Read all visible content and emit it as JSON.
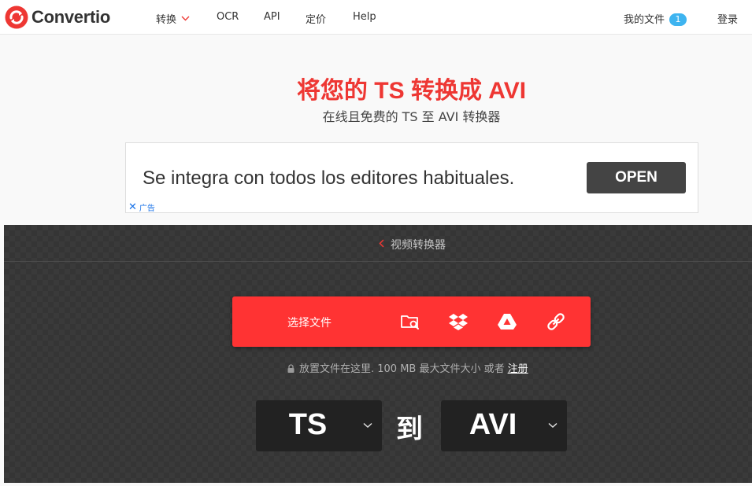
{
  "header": {
    "logo_text": "Convertio",
    "nav": {
      "convert": "转换",
      "ocr": "OCR",
      "api": "API",
      "pricing": "定价",
      "help": "Help"
    },
    "my_files": "我的文件",
    "my_files_count": "1",
    "login": "登录",
    "brand_color": "#ee3733",
    "badge_color": "#3eb4f0"
  },
  "hero": {
    "title": "将您的 TS 转换成 AVI",
    "subtitle": "在线且免费的 TS 至 AVI 转换器"
  },
  "ad": {
    "text": "Se integra con todos los editores habituales.",
    "open_label": "OPEN",
    "ad_label": "广告"
  },
  "converter": {
    "breadcrumb": "视频转换器",
    "choose_files": "选择文件",
    "upload_icons": [
      "folder-search-icon",
      "dropbox-icon",
      "google-drive-icon",
      "link-icon"
    ],
    "hint": "放置文件在这里. 100 MB 最大文件大小 或者",
    "signup": "注册",
    "from_format": "TS",
    "to_label": "到",
    "to_format": "AVI",
    "button_color": "#ff3333"
  }
}
